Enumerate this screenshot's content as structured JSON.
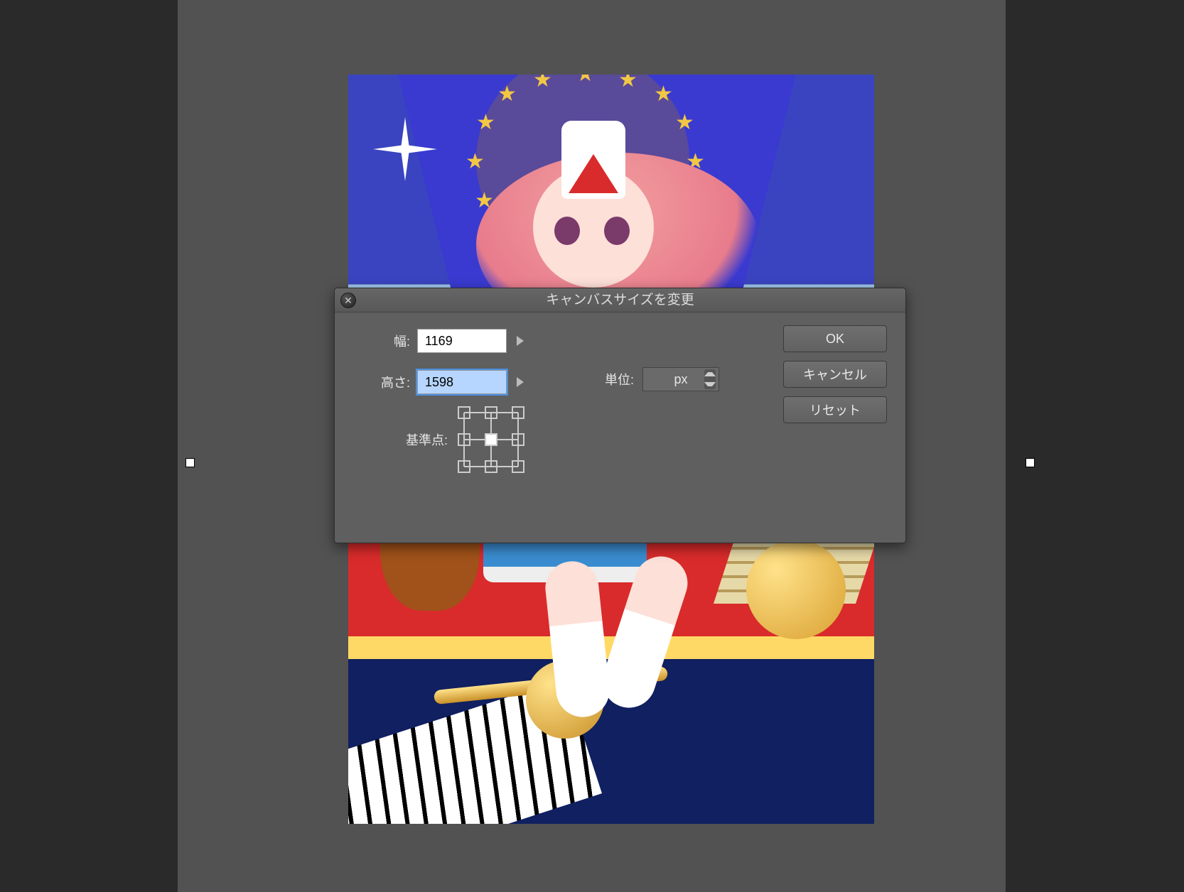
{
  "dialog": {
    "title": "キャンバスサイズを変更",
    "width_label": "幅:",
    "width_value": "1169",
    "height_label": "高さ:",
    "height_value": "1598",
    "unit_label": "単位:",
    "unit_value": "px",
    "anchor_label": "基準点:",
    "anchor_selected": "center",
    "ok": "OK",
    "cancel": "キャンセル",
    "reset": "リセット"
  }
}
